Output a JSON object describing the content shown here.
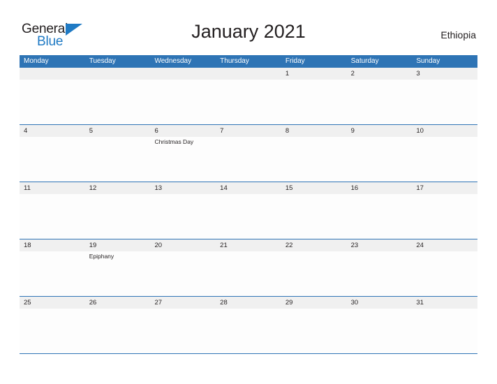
{
  "brand": {
    "logo_line1": "General",
    "logo_line2": "Blue",
    "triangle_icon": "blue-triangle-icon",
    "color_primary": "#2e74b5",
    "color_logo_blue": "#1f7ac4"
  },
  "header": {
    "title": "January 2021",
    "country": "Ethiopia"
  },
  "calendar": {
    "weekdays": [
      "Monday",
      "Tuesday",
      "Wednesday",
      "Thursday",
      "Friday",
      "Saturday",
      "Sunday"
    ],
    "weeks": [
      [
        {
          "day": "",
          "events": []
        },
        {
          "day": "",
          "events": []
        },
        {
          "day": "",
          "events": []
        },
        {
          "day": "",
          "events": []
        },
        {
          "day": "1",
          "events": []
        },
        {
          "day": "2",
          "events": []
        },
        {
          "day": "3",
          "events": []
        }
      ],
      [
        {
          "day": "4",
          "events": []
        },
        {
          "day": "5",
          "events": []
        },
        {
          "day": "6",
          "events": [
            "Christmas Day"
          ]
        },
        {
          "day": "7",
          "events": []
        },
        {
          "day": "8",
          "events": []
        },
        {
          "day": "9",
          "events": []
        },
        {
          "day": "10",
          "events": []
        }
      ],
      [
        {
          "day": "11",
          "events": []
        },
        {
          "day": "12",
          "events": []
        },
        {
          "day": "13",
          "events": []
        },
        {
          "day": "14",
          "events": []
        },
        {
          "day": "15",
          "events": []
        },
        {
          "day": "16",
          "events": []
        },
        {
          "day": "17",
          "events": []
        }
      ],
      [
        {
          "day": "18",
          "events": []
        },
        {
          "day": "19",
          "events": [
            "Epiphany"
          ]
        },
        {
          "day": "20",
          "events": []
        },
        {
          "day": "21",
          "events": []
        },
        {
          "day": "22",
          "events": []
        },
        {
          "day": "23",
          "events": []
        },
        {
          "day": "24",
          "events": []
        }
      ],
      [
        {
          "day": "25",
          "events": []
        },
        {
          "day": "26",
          "events": []
        },
        {
          "day": "27",
          "events": []
        },
        {
          "day": "28",
          "events": []
        },
        {
          "day": "29",
          "events": []
        },
        {
          "day": "30",
          "events": []
        },
        {
          "day": "31",
          "events": []
        }
      ]
    ]
  }
}
